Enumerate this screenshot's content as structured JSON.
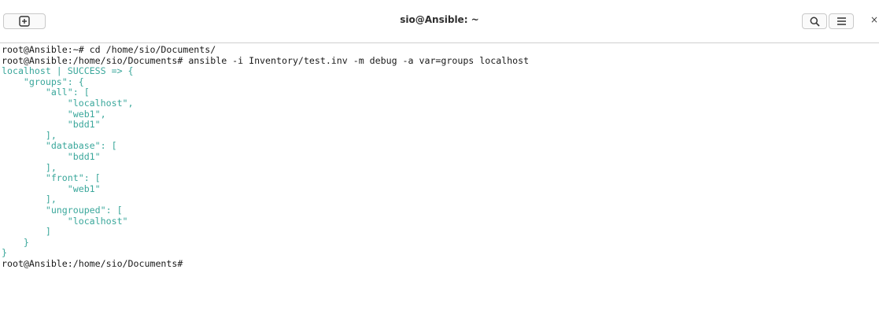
{
  "window": {
    "title": "sio@Ansible: ~",
    "close_glyph": "×"
  },
  "toolbar": {
    "new_tab_icon": "plus-square-icon",
    "search_icon": "search-icon",
    "menu_icon": "hamburger-menu-icon"
  },
  "colors": {
    "command_text": "#1a1a1a",
    "output_text": "#3aa79b"
  },
  "terminal": {
    "lines": [
      {
        "kind": "cmd",
        "text": "root@Ansible:~# cd /home/sio/Documents/"
      },
      {
        "kind": "cmd",
        "text": "root@Ansible:/home/sio/Documents# ansible -i Inventory/test.inv -m debug -a var=groups localhost"
      },
      {
        "kind": "out",
        "text": "localhost | SUCCESS => {"
      },
      {
        "kind": "out",
        "text": "    \"groups\": {"
      },
      {
        "kind": "out",
        "text": "        \"all\": ["
      },
      {
        "kind": "out",
        "text": "            \"localhost\","
      },
      {
        "kind": "out",
        "text": "            \"web1\","
      },
      {
        "kind": "out",
        "text": "            \"bdd1\""
      },
      {
        "kind": "out",
        "text": "        ],"
      },
      {
        "kind": "out",
        "text": "        \"database\": ["
      },
      {
        "kind": "out",
        "text": "            \"bdd1\""
      },
      {
        "kind": "out",
        "text": "        ],"
      },
      {
        "kind": "out",
        "text": "        \"front\": ["
      },
      {
        "kind": "out",
        "text": "            \"web1\""
      },
      {
        "kind": "out",
        "text": "        ],"
      },
      {
        "kind": "out",
        "text": "        \"ungrouped\": ["
      },
      {
        "kind": "out",
        "text": "            \"localhost\""
      },
      {
        "kind": "out",
        "text": "        ]"
      },
      {
        "kind": "out",
        "text": "    }"
      },
      {
        "kind": "out",
        "text": "}"
      },
      {
        "kind": "cmd",
        "text": "root@Ansible:/home/sio/Documents# "
      }
    ]
  }
}
